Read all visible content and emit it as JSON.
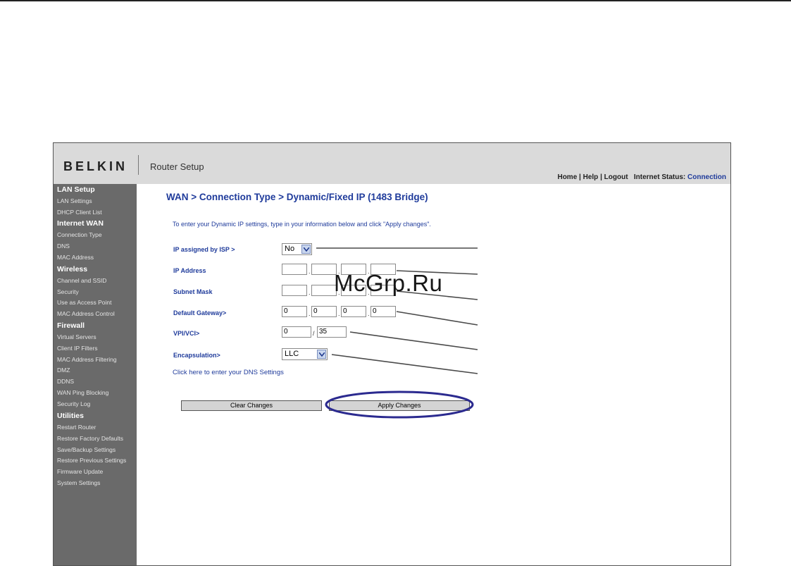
{
  "header": {
    "brand": "BELKIN",
    "app_title": "Router Setup",
    "nav": {
      "home": "Home",
      "help": "Help",
      "logout": "Logout",
      "sep": " | ",
      "status_label": "Internet Status:",
      "status_value": "Connection"
    }
  },
  "sidebar": {
    "sections": [
      {
        "title": "LAN Setup",
        "items": [
          "LAN Settings",
          "DHCP Client List"
        ]
      },
      {
        "title": "Internet WAN",
        "items": [
          "Connection Type",
          "DNS",
          "MAC Address"
        ]
      },
      {
        "title": "Wireless",
        "items": [
          "Channel and SSID",
          "Security",
          "Use as Access Point",
          "MAC Address Control"
        ]
      },
      {
        "title": "Firewall",
        "items": [
          "Virtual Servers",
          "Client IP Filters",
          "MAC Address Filtering",
          "DMZ",
          "DDNS",
          "WAN Ping Blocking",
          "Security Log"
        ]
      },
      {
        "title": "Utilities",
        "items": [
          "Restart Router",
          "Restore Factory Defaults",
          "Save/Backup Settings",
          "Restore Previous Settings",
          "Firmware Update",
          "System Settings"
        ]
      }
    ]
  },
  "main": {
    "title": "WAN > Connection Type > Dynamic/Fixed IP (1483 Bridge)",
    "intro": "To enter your Dynamic IP settings, type in your information below and click \"Apply changes\".",
    "ip_assigned": {
      "label": "IP assigned by ISP >",
      "value": "No"
    },
    "ip_address": {
      "label": "IP Address",
      "octets": [
        "",
        "",
        "",
        ""
      ]
    },
    "subnet_mask": {
      "label": "Subnet Mask",
      "octets": [
        "",
        "",
        "",
        ""
      ]
    },
    "default_gateway": {
      "label": "Default Gateway>",
      "octets": [
        "0",
        "0",
        "0",
        "0"
      ]
    },
    "vpi_vci": {
      "label": "VPI/VCI>",
      "vpi": "0",
      "sep": "/",
      "vci": "35"
    },
    "encapsulation": {
      "label": "Encapsulation>",
      "value": "LLC"
    },
    "dns_link": "Click here to enter your DNS Settings",
    "buttons": {
      "clear": "Clear Changes",
      "apply": "Apply Changes"
    }
  },
  "watermark": "McGrp.Ru",
  "colors": {
    "accent": "#1f3b9b",
    "sidebar": "#6a6a6a",
    "header": "#dadada",
    "highlight": "#2b2a8f"
  }
}
